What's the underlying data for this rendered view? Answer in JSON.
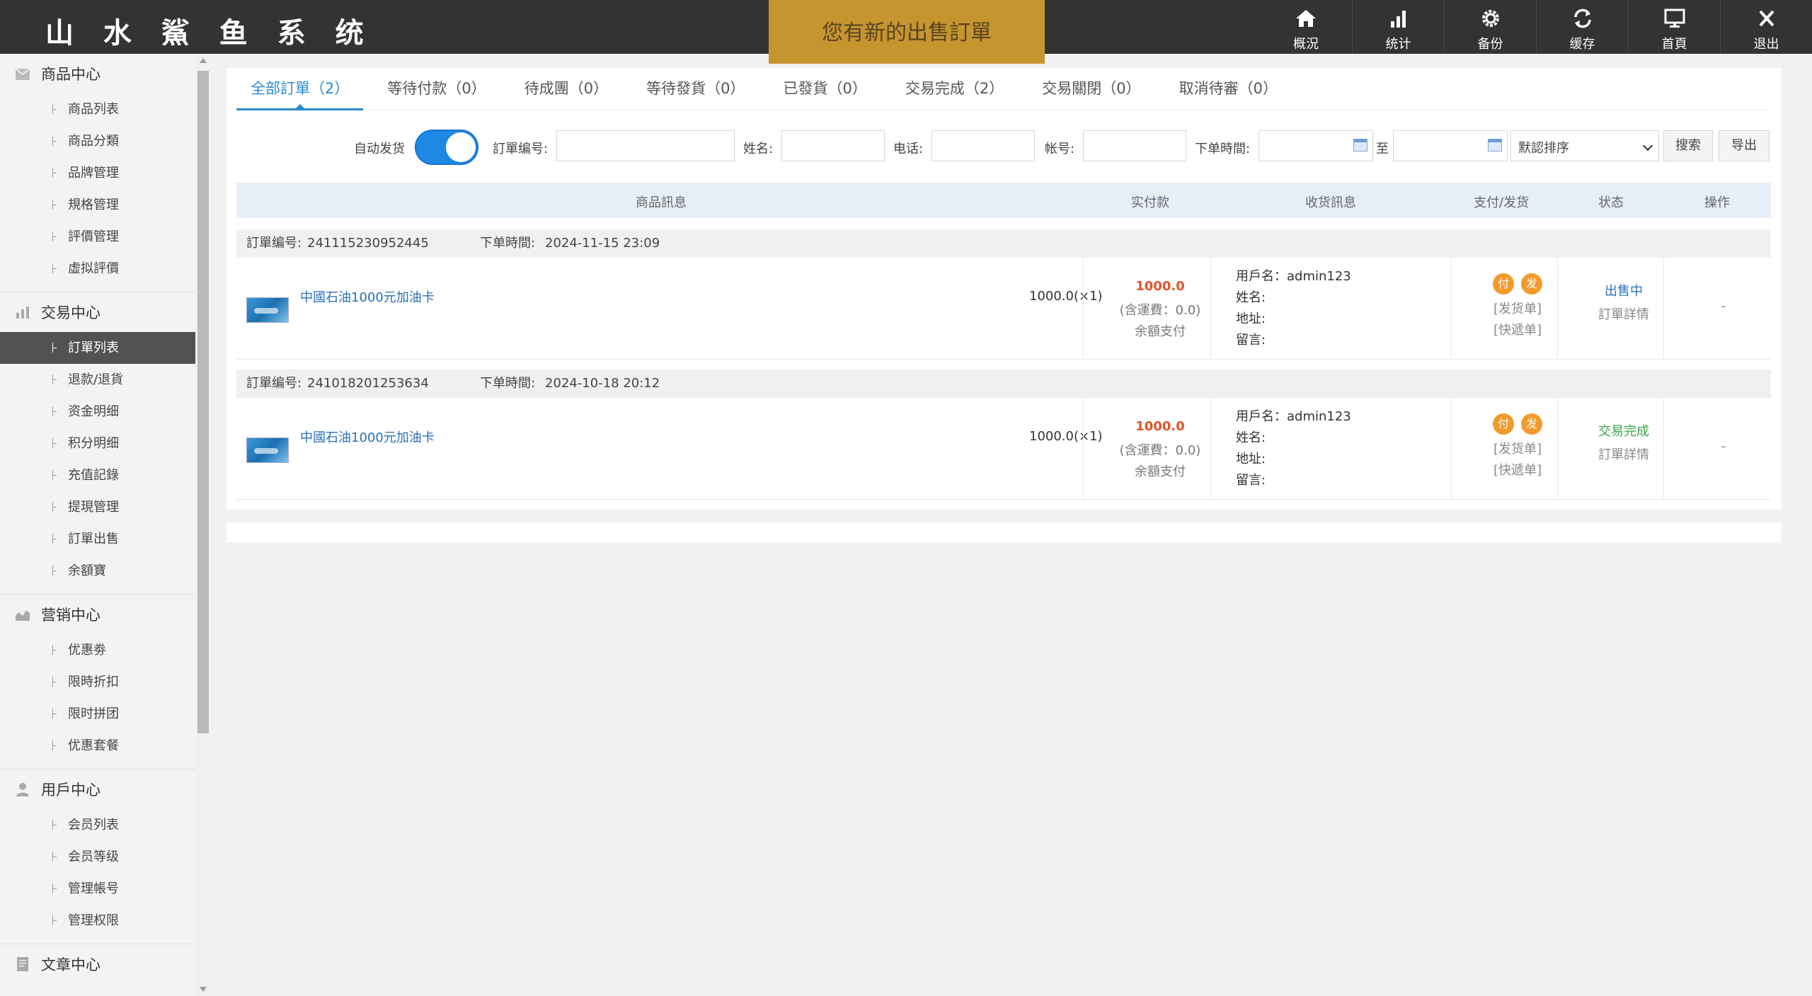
{
  "app": {
    "logo": "山 水 鯊 鱼 系 统",
    "notice": "您有新的出售訂單"
  },
  "topnav": [
    {
      "label": "概況",
      "icon": "home-icon"
    },
    {
      "label": "统计",
      "icon": "bar-chart-icon"
    },
    {
      "label": "备份",
      "icon": "gear-icon"
    },
    {
      "label": "缓存",
      "icon": "refresh-icon"
    },
    {
      "label": "首頁",
      "icon": "monitor-icon"
    },
    {
      "label": "退出",
      "icon": "close-icon"
    }
  ],
  "sidebar": {
    "groups": [
      {
        "title": "商品中心",
        "icon": "box-icon",
        "items": [
          "商品列表",
          "商品分類",
          "品牌管理",
          "規格管理",
          "評價管理",
          "虛拟評價"
        ]
      },
      {
        "title": "交易中心",
        "icon": "bar-chart-icon",
        "items": [
          "訂單列表",
          "退款/退貨",
          "资金明细",
          "积分明细",
          "充值記錄",
          "提現管理",
          "訂單出售",
          "余額寶"
        ]
      },
      {
        "title": "营销中心",
        "icon": "area-chart-icon",
        "items": [
          "优惠劵",
          "限時折扣",
          "限时拼团",
          "优惠套餐"
        ]
      },
      {
        "title": "用戶中心",
        "icon": "user-icon",
        "items": [
          "会员列表",
          "会员等级",
          "管理帳号",
          "管理权限"
        ]
      },
      {
        "title": "文章中心",
        "icon": "document-icon",
        "items": []
      }
    ],
    "active_item": "訂單列表"
  },
  "tabs": [
    "全部訂單（2）",
    "等待付款（0）",
    "待成團（0）",
    "等待發貨（0）",
    "已發貨（0）",
    "交易完成（2）",
    "交易關閉（0）",
    "取消待審（0）"
  ],
  "filters": {
    "auto_ship_label": "自动发货",
    "auto_ship_on": true,
    "order_no_label": "訂單编号:",
    "name_label": "姓名:",
    "phone_label": "电话:",
    "account_label": "帐号:",
    "time_label": "下单時間:",
    "to_label": "至",
    "sort_value": "默認排序",
    "search_label": "搜索",
    "export_label": "导出"
  },
  "table": {
    "headers": {
      "product": "商品訊息",
      "paid": "实付款",
      "receiver": "收货訊息",
      "pay_ship": "支付/发货",
      "status": "状态",
      "ops": "操作"
    }
  },
  "orders": [
    {
      "order_no_label": "訂單编号:",
      "order_no": "241115230952445",
      "time_label": "下单時間:",
      "time": "2024-11-15 23:09",
      "product": "中國石油1000元加油卡",
      "qty": "1000.0(×1)",
      "amount": "1000.0",
      "fee": "(含運費：0.0)",
      "method": "余額支付",
      "recv_user": "用戶名：admin123",
      "recv_name": "姓名:",
      "recv_addr": "地址:",
      "recv_note": "留言:",
      "badge_pay": "付",
      "badge_ship": "发",
      "ship_doc": "[发货单]",
      "express_doc": "[快遞单]",
      "status": "出售中",
      "status_color": "#2a6fb8",
      "detail": "訂單詳情",
      "ops": "-"
    },
    {
      "order_no_label": "訂單编号:",
      "order_no": "241018201253634",
      "time_label": "下单時間:",
      "time": "2024-10-18 20:12",
      "product": "中國石油1000元加油卡",
      "qty": "1000.0(×1)",
      "amount": "1000.0",
      "fee": "(含運費：0.0)",
      "method": "余額支付",
      "recv_user": "用戶名：admin123",
      "recv_name": "姓名:",
      "recv_addr": "地址:",
      "recv_note": "留言:",
      "badge_pay": "付",
      "badge_ship": "发",
      "ship_doc": "[发货单]",
      "express_doc": "[快遞单]",
      "status": "交易完成",
      "status_color": "#3aa64a",
      "detail": "訂單詳情",
      "ops": "-"
    }
  ]
}
